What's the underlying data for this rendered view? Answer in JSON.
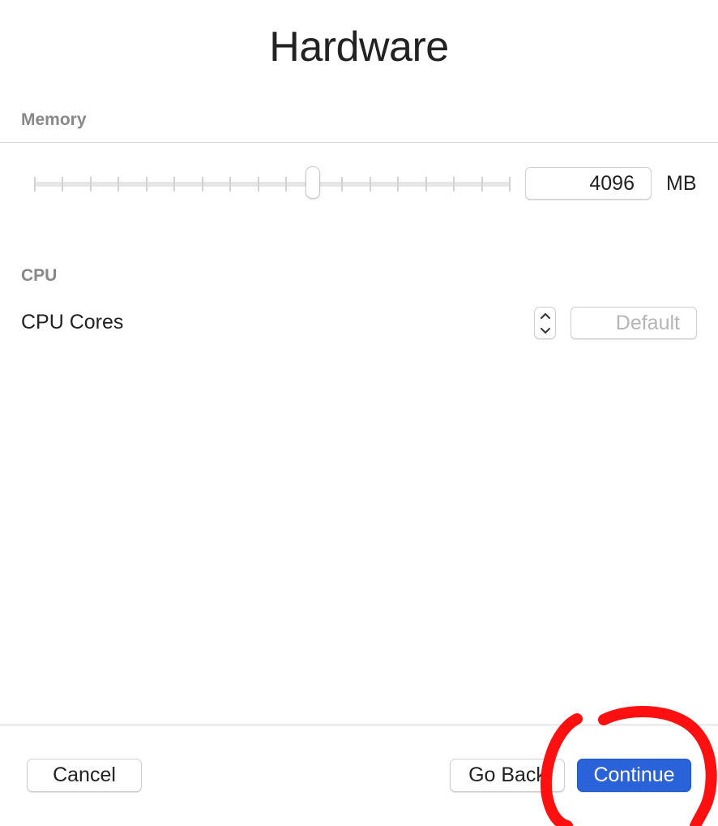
{
  "title": "Hardware",
  "memory": {
    "section_label": "Memory",
    "slider_fraction": 0.586,
    "tick_count": 18,
    "value": "4096",
    "unit": "MB"
  },
  "cpu": {
    "section_label": "CPU",
    "cores_label": "CPU Cores",
    "cores_placeholder": "Default"
  },
  "footer": {
    "cancel_label": "Cancel",
    "go_back_label": "Go Back",
    "continue_label": "Continue"
  },
  "colors": {
    "accent": "#2a63d9",
    "annotation": "#ff1010"
  }
}
